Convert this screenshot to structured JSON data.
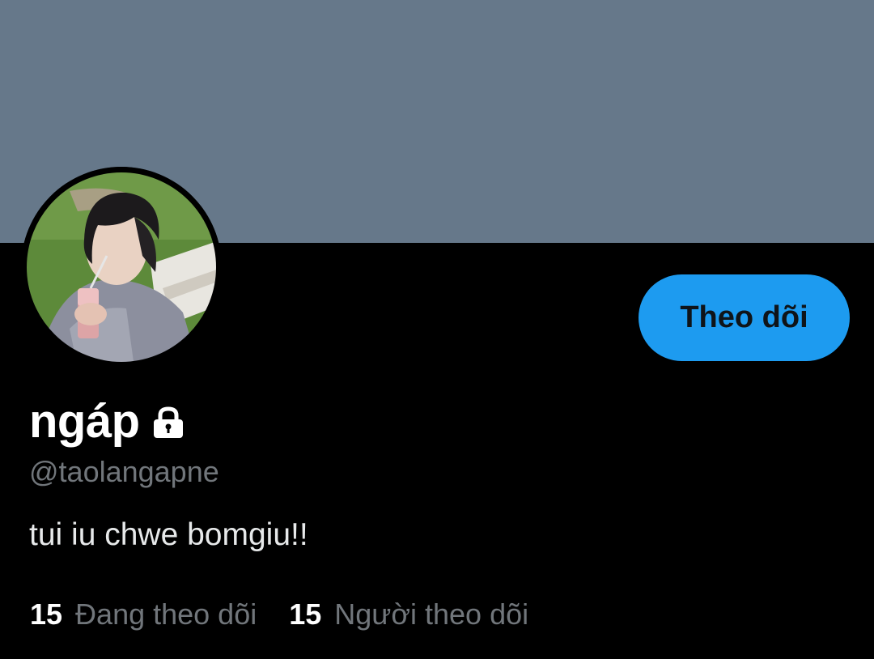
{
  "profile": {
    "banner_color": "#66788a",
    "avatar_icon": "profile-photo",
    "display_name": "ngáp",
    "protected_icon": "lock-icon",
    "handle": "@taolangapne",
    "bio": "tui iu chwe bomgiu!!"
  },
  "actions": {
    "follow_label": "Theo dõi",
    "follow_color": "#1d9bf0"
  },
  "stats": {
    "following_count": "15",
    "following_label": "Đang theo dõi",
    "followers_count": "15",
    "followers_label": "Người theo dõi"
  }
}
